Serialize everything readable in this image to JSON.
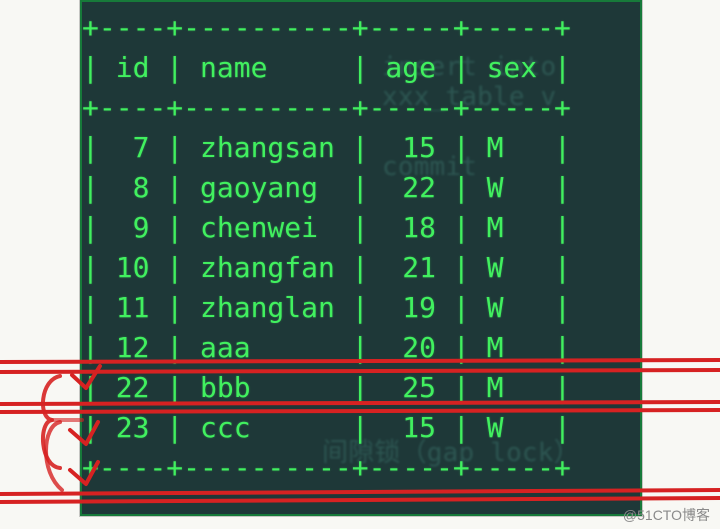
{
  "table": {
    "columns": [
      "id",
      "name",
      "age",
      "sex"
    ],
    "rows": [
      {
        "id": "7",
        "name": "zhangsan",
        "age": "15",
        "sex": "M"
      },
      {
        "id": "8",
        "name": "gaoyang",
        "age": "22",
        "sex": "W"
      },
      {
        "id": "9",
        "name": "chenwei",
        "age": "18",
        "sex": "M"
      },
      {
        "id": "10",
        "name": "zhangfan",
        "age": "21",
        "sex": "W"
      },
      {
        "id": "11",
        "name": "zhanglan",
        "age": "19",
        "sex": "W"
      },
      {
        "id": "12",
        "name": "aaa",
        "age": "20",
        "sex": "M"
      },
      {
        "id": "22",
        "name": "bbb",
        "age": "25",
        "sex": "M"
      },
      {
        "id": "23",
        "name": "ccc",
        "age": "15",
        "sex": "W"
      }
    ]
  },
  "ghost_text": {
    "g1": "insert into xxx_table v",
    "g2": "commit",
    "g3": "间隙锁（gap lock）"
  },
  "watermark": "@51CTO博客",
  "ascii": {
    "rule": "+----+----------+-----+-----+",
    "head": "| id | name     | age | sex |"
  }
}
